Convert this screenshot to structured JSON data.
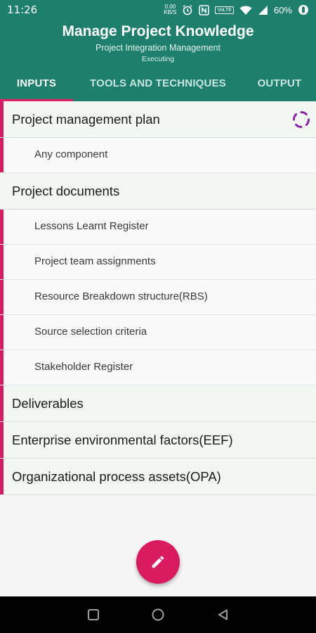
{
  "status_bar": {
    "time": "11:26",
    "net_speed": "0.00",
    "net_unit": "KB/S",
    "volte": "VoLTE",
    "battery": "60%"
  },
  "header": {
    "title": "Manage Project Knowledge",
    "subtitle": "Project Integration Management",
    "phase": "Executing"
  },
  "tabs": [
    {
      "label": "INPUTS",
      "active": true
    },
    {
      "label": "TOOLS AND TECHNIQUES",
      "active": false
    },
    {
      "label": "OUTPUT",
      "active": false
    }
  ],
  "groups": {
    "pmp": {
      "label": "Project management plan",
      "items": [
        "Any component"
      ]
    },
    "docs": {
      "label": "Project documents",
      "items": [
        "Lessons Learnt Register",
        "Project team assignments",
        "Resource Breakdown structure(RBS)",
        "Source selection criteria",
        "Stakeholder Register"
      ]
    },
    "deliverables": {
      "label": "Deliverables"
    },
    "eef": {
      "label": "Enterprise environmental factors(EEF)"
    },
    "opa": {
      "label": "Organizational process assets(OPA)"
    }
  },
  "colors": {
    "primary": "#1e7f6c",
    "accent": "#d81b60",
    "spinner": "#8e24aa"
  },
  "icons": {
    "fab": "edit-pencil-icon",
    "group_action": "loading-spinner-icon",
    "nav": [
      "recents-square-icon",
      "home-circle-icon",
      "back-triangle-icon"
    ]
  }
}
